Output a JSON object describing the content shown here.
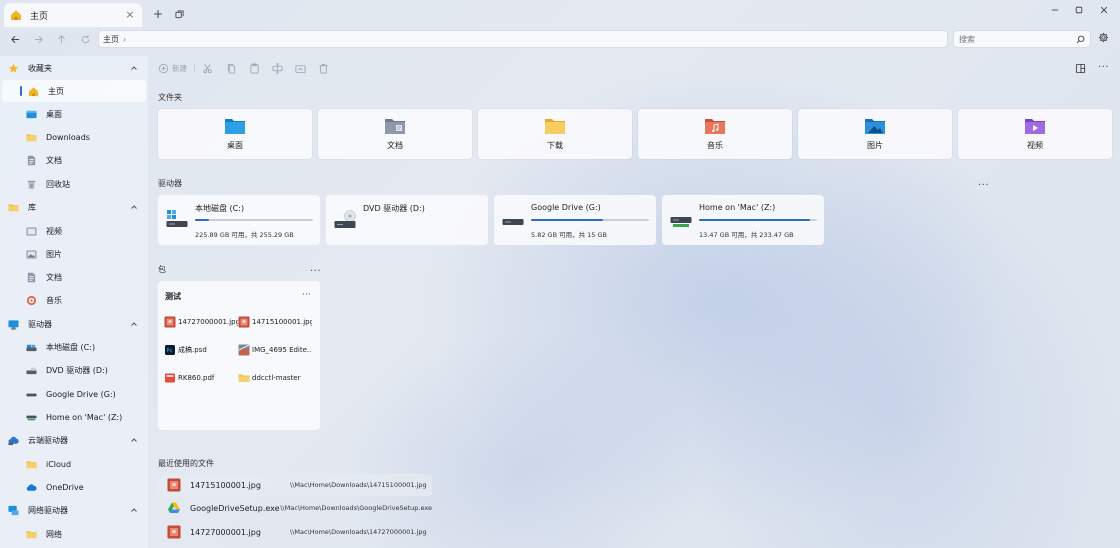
{
  "window": {
    "tab_label": "主页",
    "tab_close": "×",
    "new_tab": "+",
    "accent": "#2a6fd1"
  },
  "address": {
    "crumb": "主页",
    "crumb_sep": "›",
    "search_placeholder": "搜索"
  },
  "sidebar": {
    "groups": [
      {
        "label": "收藏夹",
        "icon": "star-icon",
        "items": [
          {
            "label": "主页",
            "icon": "home-icon",
            "active": true
          },
          {
            "label": "桌面",
            "icon": "desktop-icon"
          },
          {
            "label": "Downloads",
            "icon": "folder-icon"
          },
          {
            "label": "文档",
            "icon": "document-icon"
          },
          {
            "label": "回收站",
            "icon": "recycle-bin-icon"
          }
        ]
      },
      {
        "label": "库",
        "icon": "library-folder-icon",
        "items": [
          {
            "label": "视频",
            "icon": "video-icon"
          },
          {
            "label": "图片",
            "icon": "picture-icon"
          },
          {
            "label": "文档",
            "icon": "document-icon"
          },
          {
            "label": "音乐",
            "icon": "music-icon"
          }
        ]
      },
      {
        "label": "驱动器",
        "icon": "computer-icon",
        "items": [
          {
            "label": "本地磁盘 (C:)",
            "icon": "drive-icon"
          },
          {
            "label": "DVD 驱动器 (D:)",
            "icon": "dvd-drive-icon"
          },
          {
            "label": "Google Drive (G:)",
            "icon": "drive-icon"
          },
          {
            "label": "Home on 'Mac' (Z:)",
            "icon": "network-drive-icon"
          }
        ]
      },
      {
        "label": "云端驱动器",
        "icon": "cloud-icon",
        "items": [
          {
            "label": "iCloud",
            "icon": "folder-icon"
          },
          {
            "label": "OneDrive",
            "icon": "onedrive-icon"
          }
        ]
      },
      {
        "label": "网络驱动器",
        "icon": "network-icon",
        "items": [
          {
            "label": "网络",
            "icon": "folder-icon"
          }
        ]
      }
    ]
  },
  "toolbar": {
    "new_label": "新建"
  },
  "sections": {
    "folders": "文件夹",
    "drives": "驱动器",
    "bundles": "包",
    "recent": "最近使用的文件",
    "more": "···"
  },
  "folders": [
    {
      "label": "桌面",
      "icon": "desktop-folder-icon",
      "color": "#1e8fd8"
    },
    {
      "label": "文档",
      "icon": "documents-folder-icon",
      "color": "#8590a0"
    },
    {
      "label": "下载",
      "icon": "downloads-folder-icon",
      "color": "#f2c14e"
    },
    {
      "label": "音乐",
      "icon": "music-folder-icon",
      "color": "#e0674f"
    },
    {
      "label": "图片",
      "icon": "pictures-folder-icon",
      "color": "#1f8bd6"
    },
    {
      "label": "视频",
      "icon": "videos-folder-icon",
      "color": "#9a5bd6"
    }
  ],
  "drives": [
    {
      "name": "本地磁盘 (C:)",
      "info": "225.89 GB 可用，共 255.29 GB",
      "used_fraction": 0.115,
      "icon": "windows-drive-icon"
    },
    {
      "name": "DVD 驱动器 (D:)",
      "info": "",
      "used_fraction": 0,
      "icon": "dvd-drive-icon"
    },
    {
      "name": "Google Drive (G:)",
      "info": "5.82 GB 可用，共 15 GB",
      "used_fraction": 0.612,
      "icon": "drive-icon"
    },
    {
      "name": "Home on 'Mac' (Z:)",
      "info": "13.47 GB 可用，共 233.47 GB",
      "used_fraction": 0.942,
      "icon": "network-drive-icon"
    }
  ],
  "bundle": {
    "title": "测试",
    "more": "···",
    "files": [
      {
        "name": "14727000001.jpg",
        "icon": "image-file-icon"
      },
      {
        "name": "14715100001.jpg",
        "icon": "image-file-icon"
      },
      {
        "name": "成稿.psd",
        "icon": "photoshop-file-icon"
      },
      {
        "name": "IMG_4695 Edite...",
        "icon": "image-file-icon"
      },
      {
        "name": "RK860.pdf",
        "icon": "pdf-file-icon"
      },
      {
        "name": "ddcctl-master",
        "icon": "folder-icon"
      }
    ]
  },
  "recent": [
    {
      "name": "14715100001.jpg",
      "path": "\\\\Mac\\Home\\Downloads\\14715100001.jpg",
      "icon": "image-file-icon"
    },
    {
      "name": "GoogleDriveSetup.exe",
      "path": "\\\\Mac\\Home\\Downloads\\GoogleDriveSetup.exe",
      "icon": "google-drive-icon"
    },
    {
      "name": "14727000001.jpg",
      "path": "\\\\Mac\\Home\\Downloads\\14727000001.jpg",
      "icon": "image-file-icon"
    }
  ]
}
